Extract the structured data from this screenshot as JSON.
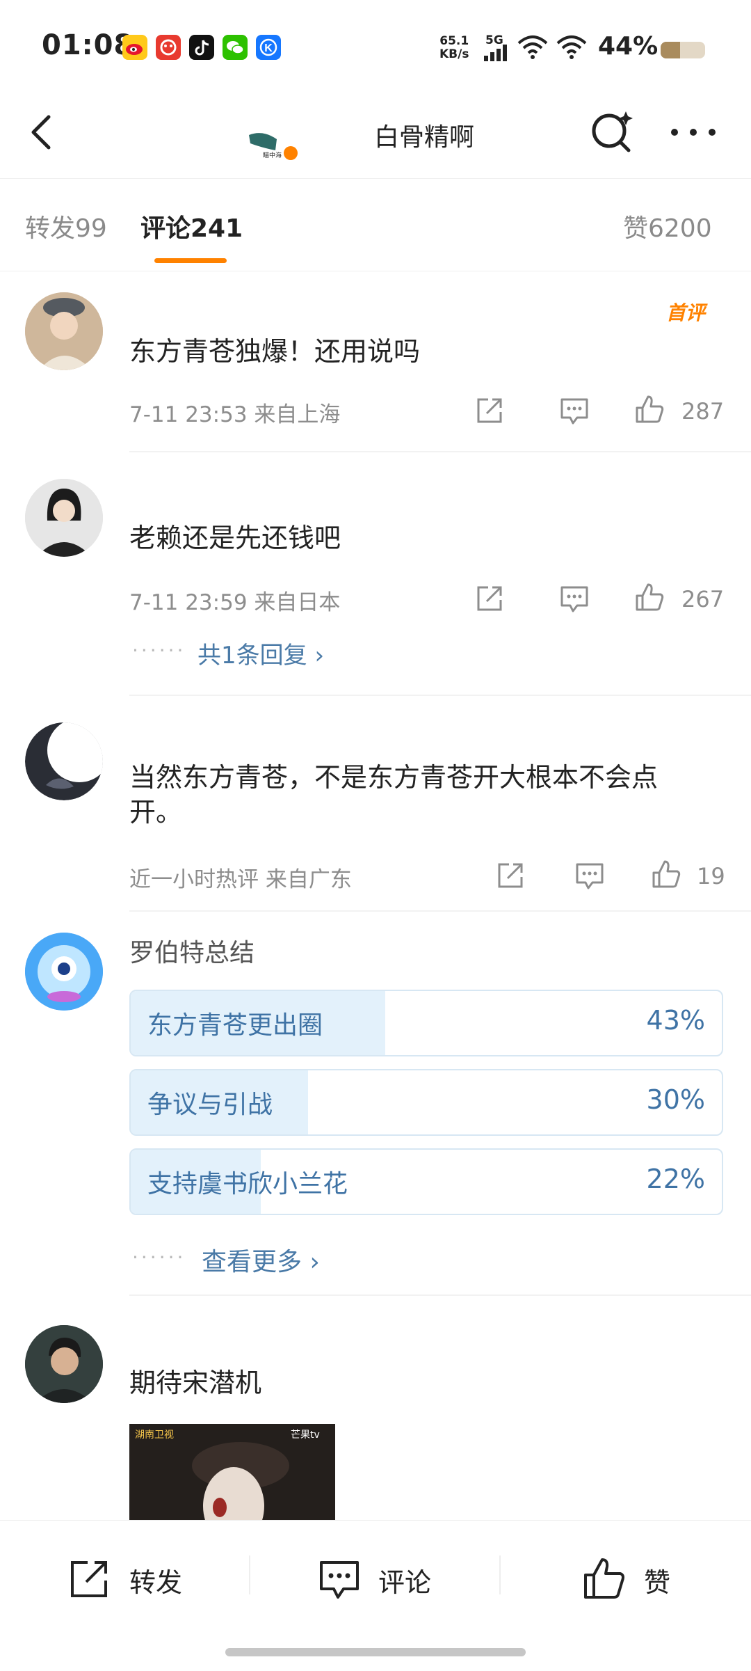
{
  "status_bar": {
    "time": "01:08",
    "net_speed_value": "65.1",
    "net_speed_unit": "KB/s",
    "network_type": "5G",
    "battery_percent": "44%",
    "battery_level": 0.44,
    "app_icons": [
      "weibo-icon",
      "app-red-icon",
      "tiktok-icon",
      "wechat-icon",
      "app-blue-k-icon"
    ]
  },
  "header": {
    "title": "白骨精啊",
    "thumbnail_caption": "瞄中海"
  },
  "tabs": {
    "repost": "转发99",
    "comment": "评论241",
    "like": "赞6200"
  },
  "comments": [
    {
      "text": "东方青苍独爆！还用说吗",
      "meta": "7-11 23:53  来自上海",
      "likes": "287",
      "badge": "首评"
    },
    {
      "text": "老赖还是先还钱吧",
      "meta": "7-11 23:59  来自日本",
      "likes": "267",
      "reply_link": "共1条回复 ›"
    },
    {
      "text": "当然东方青苍，不是东方青苍开大根本不会点开。",
      "meta": "近一小时热评  来自广东",
      "likes": "19"
    }
  ],
  "poll": {
    "author": "罗伯特总结",
    "options": [
      {
        "label": "东方青苍更出圈",
        "percent": "43%",
        "fraction": 0.43
      },
      {
        "label": "争议与引战",
        "percent": "30%",
        "fraction": 0.3
      },
      {
        "label": "支持虞书欣小兰花",
        "percent": "22%",
        "fraction": 0.22
      }
    ],
    "more_link": "查看更多 ›"
  },
  "last_comment": {
    "text": "期待宋潜机",
    "image_logo_left": "湖南卫视",
    "image_logo_right": "芒果tv"
  },
  "bottom_bar": {
    "repost": "转发",
    "comment": "评论",
    "like": "赞"
  },
  "colors": {
    "accent": "#ff8200",
    "link": "#4a7aa7",
    "poll_fill": "#e3f1fb"
  }
}
